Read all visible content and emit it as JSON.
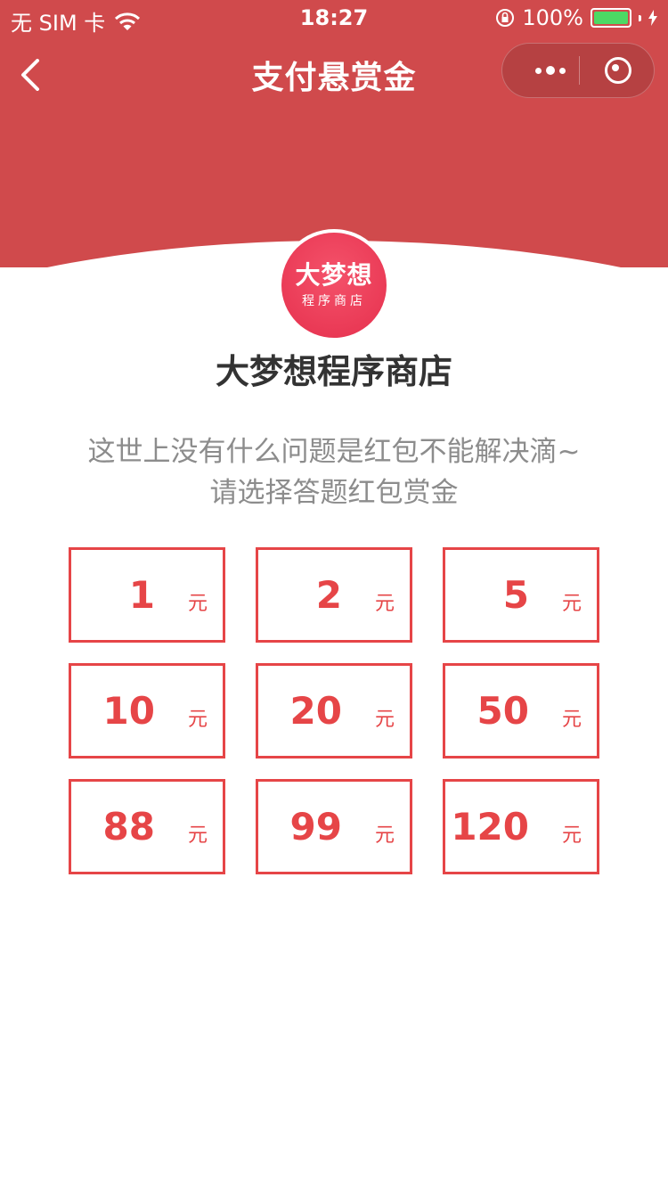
{
  "status_bar": {
    "carrier": "无 SIM 卡",
    "time": "18:27",
    "battery": "100%",
    "icons": [
      "wifi-icon",
      "orientation-lock-icon",
      "battery-icon",
      "charging-icon"
    ]
  },
  "nav": {
    "title": "支付悬赏金",
    "back_icon": "chevron-left-icon",
    "more_icon": "more-dots-icon",
    "close_icon": "target-close-icon"
  },
  "shop": {
    "logo_line1": "大梦想",
    "logo_line2": "程序商店",
    "name": "大梦想程序商店"
  },
  "description": {
    "line1": "这世上没有什么问题是红包不能解决滴~",
    "line2": "请选择答题红包赏金"
  },
  "amounts": [
    {
      "value": "1",
      "unit": "元"
    },
    {
      "value": "2",
      "unit": "元"
    },
    {
      "value": "5",
      "unit": "元"
    },
    {
      "value": "10",
      "unit": "元"
    },
    {
      "value": "20",
      "unit": "元"
    },
    {
      "value": "50",
      "unit": "元"
    },
    {
      "value": "88",
      "unit": "元"
    },
    {
      "value": "99",
      "unit": "元"
    },
    {
      "value": "120",
      "unit": "元"
    }
  ],
  "colors": {
    "header": "#d04a4c",
    "accent": "#e64547",
    "avatar": "#ea3a56",
    "text_dark": "#333333",
    "text_gray": "#8c8c8c"
  }
}
